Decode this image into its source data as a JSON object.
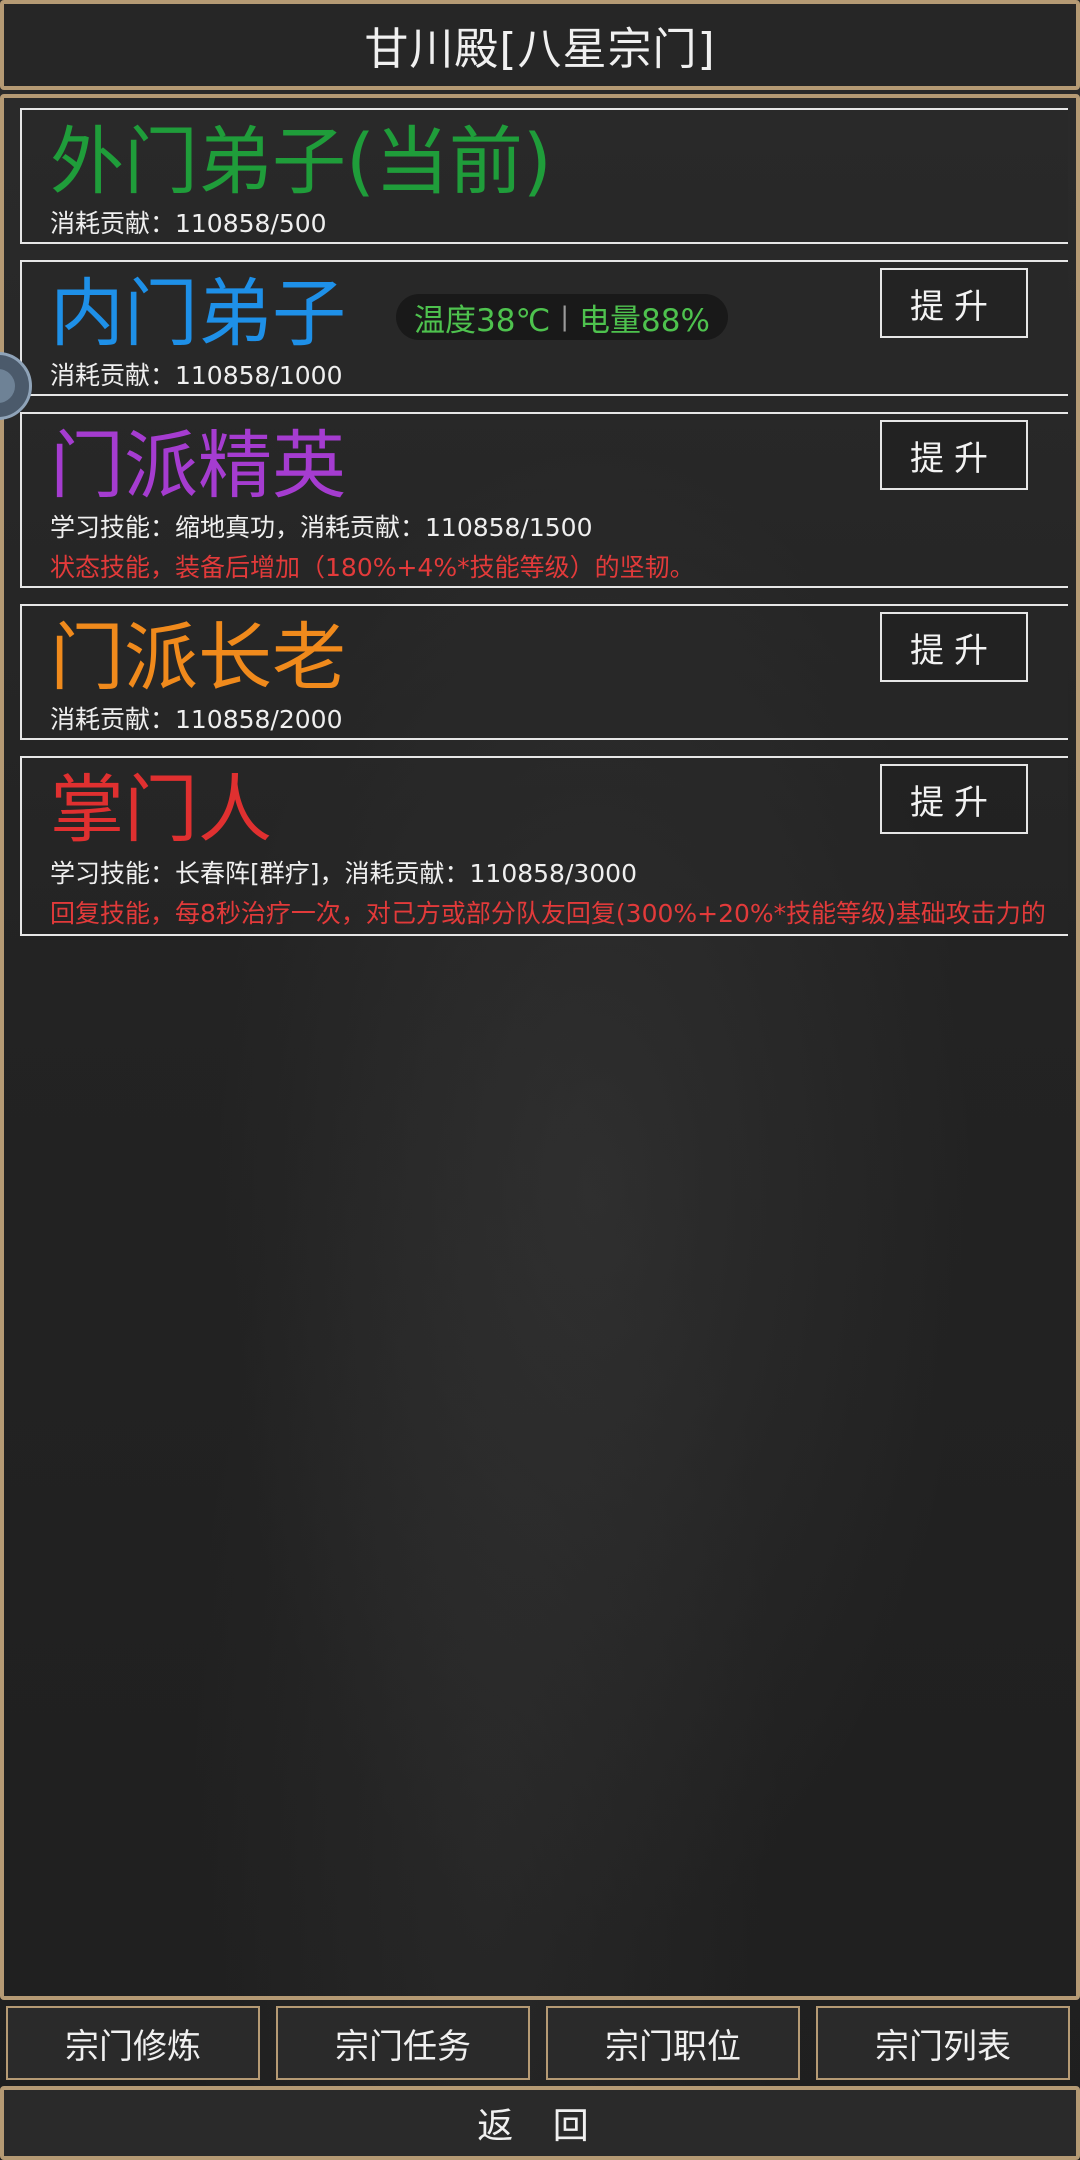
{
  "header": {
    "title": "甘川殿[八星宗门]"
  },
  "colors": {
    "green": "#1f9d3a",
    "blue": "#1e90e8",
    "purple": "#a53cd0",
    "orange": "#f08a1c",
    "red": "#e03030",
    "border_gold": "#b59a74"
  },
  "ranks": [
    {
      "name": "外门弟子(当前)",
      "cost": "消耗贡献：110858/500"
    },
    {
      "name": "内门弟子",
      "cost": "消耗贡献：110858/1000",
      "button": "提升"
    },
    {
      "name": "门派精英",
      "skill_line": "学习技能：缩地真功，消耗贡献：110858/1500",
      "desc": "状态技能，装备后增加（180%+4%*技能等级）的坚韧。",
      "button": "提升"
    },
    {
      "name": "门派长老",
      "cost": "消耗贡献：110858/2000",
      "button": "提升"
    },
    {
      "name": "掌门人",
      "skill_line": "学习技能：长春阵[群疗]，消耗贡献：110858/3000",
      "desc": "回复技能，每8秒治疗一次，对己方或部分队友回复(300%+20%*技能等级)基础攻击力的",
      "button": "提升"
    }
  ],
  "status_overlay": {
    "temperature": "温度38℃",
    "battery": "电量88%"
  },
  "tabs": [
    "宗门修炼",
    "宗门任务",
    "宗门职位",
    "宗门列表"
  ],
  "back_label": "返 回"
}
